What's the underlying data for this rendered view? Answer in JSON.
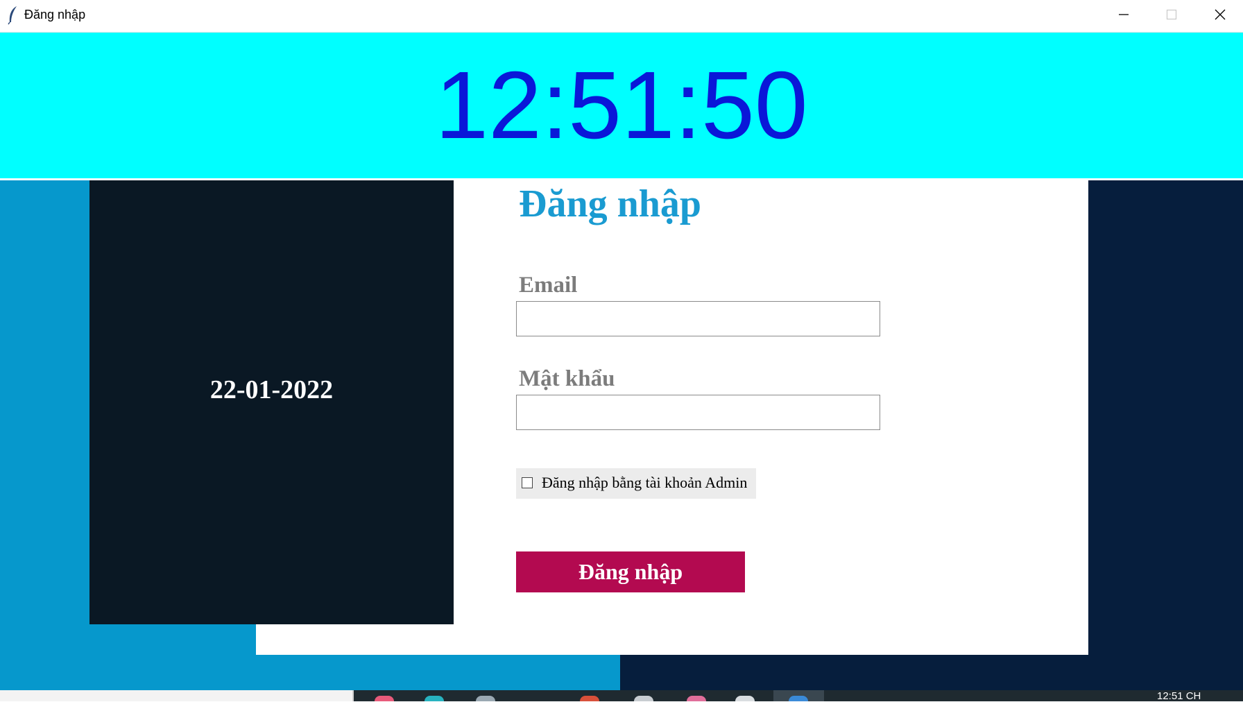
{
  "window": {
    "title": "Đăng nhập",
    "icon": "feather-icon",
    "controls": [
      "minimize-icon",
      "maximize-icon",
      "close-icon"
    ]
  },
  "clock": {
    "time": "12:51:50",
    "background": "#00ffff",
    "color": "#0a17d8"
  },
  "date_panel": {
    "date": "22-01-2022"
  },
  "form": {
    "title": "Đăng nhập",
    "email_label": "Email",
    "email_value": "",
    "password_label": "Mật khẩu",
    "password_value": "",
    "admin_checkbox_label": "Đăng nhập bằng tài khoản Admin",
    "admin_checked": false,
    "submit_label": "Đăng nhập"
  },
  "colors": {
    "accent_title": "#1a9bd1",
    "button": "#b30a50",
    "bg_left": "#0698cc",
    "bg_right": "#061e3d",
    "date_panel": "#0a1824"
  },
  "taskbar": {
    "time": "12:51 CH"
  }
}
